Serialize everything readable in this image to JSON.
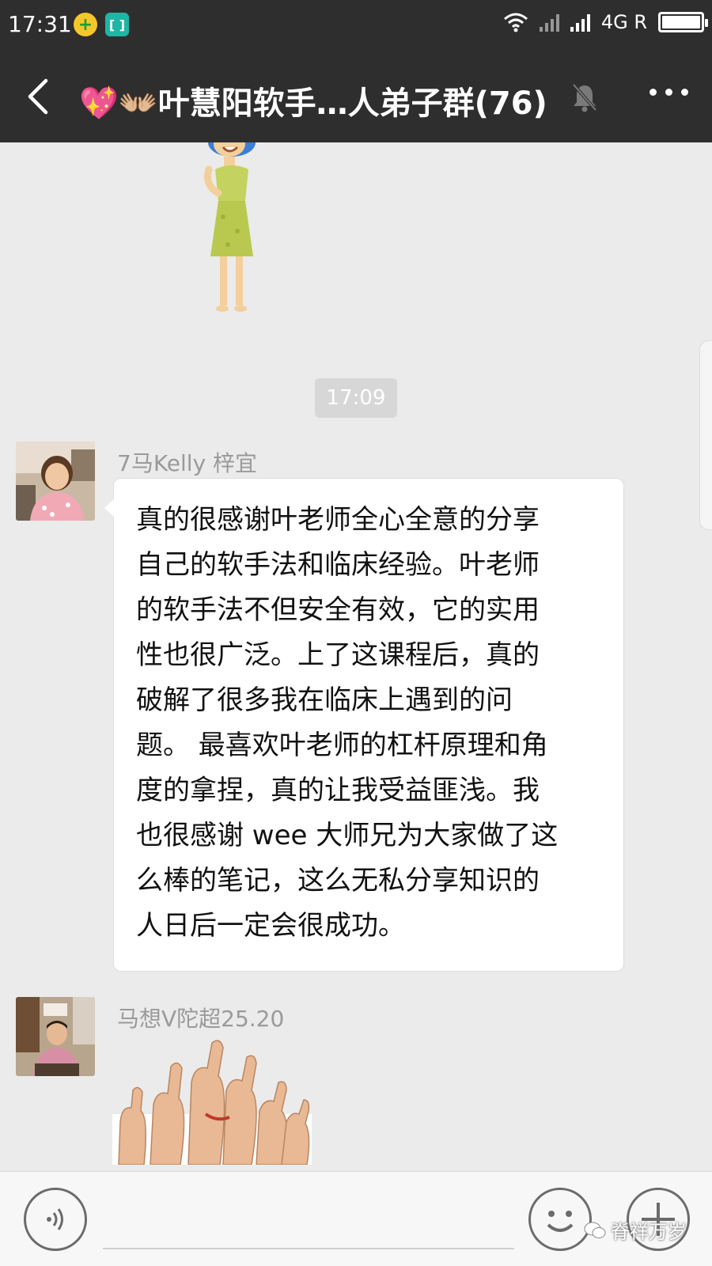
{
  "status_bar": {
    "time": "17:31",
    "network": "4G R",
    "battery_level": 1.0
  },
  "header": {
    "back_icon": "chevron-left-icon",
    "title": "💖👐🏼叶慧阳软手…人弟子群(76)",
    "mute_icon": "bell-muted-icon",
    "more_icon": "more-dots-icon"
  },
  "chat": {
    "timestamp": "17:09",
    "messages": [
      {
        "sender": "7马Kelly 梓宜",
        "lines": [
          "真的很感谢叶老师全心全意的分享",
          "自己的软手法和临床经验。叶老师",
          "的软手法不但安全有效，它的实用",
          "性也很广泛。上了这课程后，真的",
          "破解了很多我在临床上遇到的问",
          "题。 最喜欢叶老师的杠杆原理和角",
          "度的拿捏，真的让我受益匪浅。我",
          "也很感谢 wee 大师兄为大家做了这",
          "么棒的笔记，这么无私分享知识的",
          "人日后一定会很成功。"
        ]
      },
      {
        "sender": "马想V陀超25.20",
        "sticker": "thumbs-up-sticker"
      }
    ]
  },
  "input_bar": {
    "voice_icon": "voice-icon",
    "emoji_icon": "emoji-icon",
    "plus_icon": "plus-icon",
    "watermark": "脊祥万岁"
  },
  "colors": {
    "header_bg": "#2e2e2e",
    "chat_bg": "#ebebeb",
    "bubble_bg": "#ffffff",
    "time_chip_bg": "#d7d7d7"
  }
}
